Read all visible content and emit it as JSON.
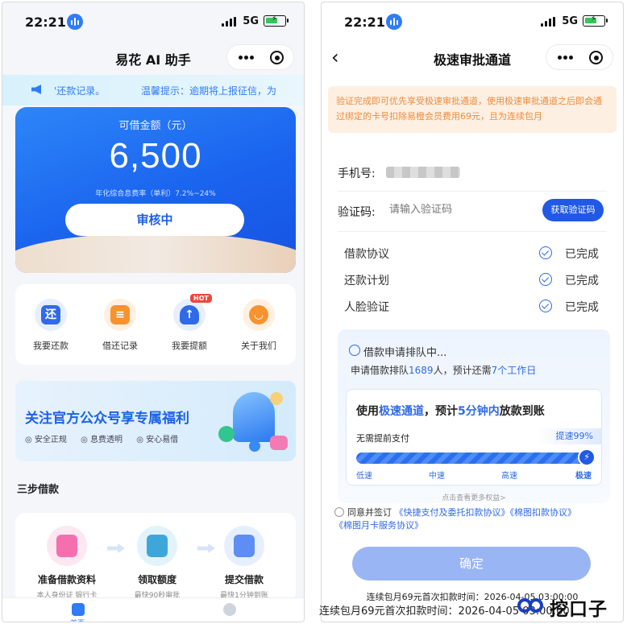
{
  "left": {
    "status": {
      "time": "22:21",
      "network": "5G"
    },
    "nav": {
      "title": "易花 AI 助手"
    },
    "notice": {
      "text": "'还款记录。",
      "text2": "温馨提示：逾期将上报征信，为"
    },
    "loan": {
      "label": "可借金额（元）",
      "amount": "6,500",
      "rate": "年化综合息费率（单利）7.2%~24%",
      "button": "审核中"
    },
    "grid": [
      {
        "label": "我要还款",
        "glyph": "还"
      },
      {
        "label": "借还记录",
        "glyph": "≡"
      },
      {
        "label": "我要提额",
        "glyph": "↑",
        "badge": "HOT"
      },
      {
        "label": "关于我们",
        "glyph": "◡"
      }
    ],
    "banner": {
      "title": "关注官方公众号享专属福利",
      "tags": [
        "安全正规",
        "息费透明",
        "安心易借"
      ]
    },
    "steps": {
      "title": "三步借款",
      "items": [
        {
          "label": "准备借款资料",
          "sub": "本人身份证 银行卡"
        },
        {
          "label": "领取额度",
          "sub": "最快90秒审批"
        },
        {
          "label": "提交借款",
          "sub": "最快1分钟到账"
        }
      ]
    },
    "tabs": {
      "home": "首页"
    }
  },
  "right": {
    "status": {
      "time": "22:21",
      "network": "5G"
    },
    "nav": {
      "title": "极速审批通道",
      "back": "‹"
    },
    "warning": "验证完成即可优先享受极速审批通道，使用极速审批通道之后即会通过绑定的卡号扣除易橙会员费用69元，且为连续包月",
    "phone_label": "手机号:",
    "code_label": "验证码:",
    "code_placeholder": "请输入验证码",
    "code_button": "获取验证码",
    "checks": [
      {
        "label": "借款协议",
        "status": "已完成"
      },
      {
        "label": "还款计划",
        "status": "已完成"
      },
      {
        "label": "人脸验证",
        "status": "已完成"
      }
    ],
    "queue": {
      "title": "借款申请排队中...",
      "line_a": "申请借款排队",
      "count": "1689",
      "line_b": "人，预计还需",
      "days": "7个工作日"
    },
    "fast": {
      "t1": "使用",
      "t2": "极速通道",
      "t3": "，预计",
      "t4": "5分钟内",
      "t5": "放款到账",
      "no_pay": "无需提前支付",
      "speed": "提速99%",
      "progress": 0.99,
      "ticks": [
        "低速",
        "中速",
        "高速",
        "极速"
      ]
    },
    "more": "点击查看更多权益>",
    "agree": {
      "prefix": "同意并签订",
      "link1": "《快捷支付及委托扣款协议》",
      "link2": "《棉图扣款协议》",
      "link3": "《棉图月卡服务协议》"
    },
    "confirm": "确定",
    "bill1": "连续包月69元首次扣款时间：2026-04-05 03:00:00",
    "bill2": "连续包月69元首次扣款时间：2026-04-05 03:00:00"
  },
  "watermark": {
    "text": "挖口子"
  },
  "colors": {
    "brand_blue": "#1a63ee",
    "warn_orange": "#ef8b3a",
    "link_blue": "#2f6ae8"
  }
}
